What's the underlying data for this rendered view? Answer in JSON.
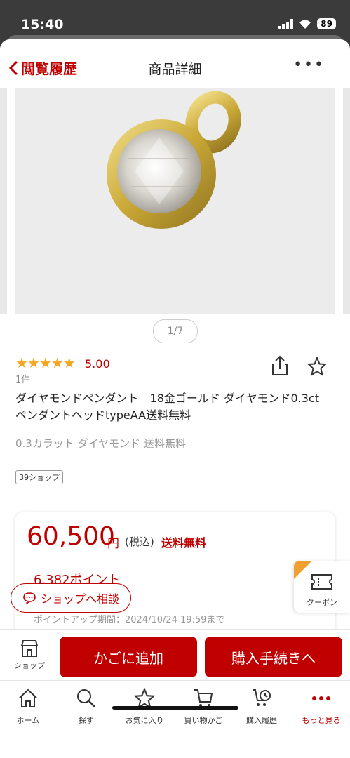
{
  "status": {
    "time": "15:40",
    "battery": "89"
  },
  "nav": {
    "back_label": "閲覧履歴",
    "title": "商品詳細",
    "more": "•••"
  },
  "gallery": {
    "pager": "1/7"
  },
  "rating": {
    "stars": "★★★★★",
    "score": "5.00",
    "count": "1件"
  },
  "product": {
    "name": "ダイヤモンドペンダント　18金ゴールド ダイヤモンド0.3ctペンダントヘッドtypeAA送料無料",
    "subtitle": "0.3カラット ダイヤモンド 送料無料",
    "tag": "39ショップ"
  },
  "price": {
    "amount": "60,500",
    "yen": "円",
    "tax": "(税込)",
    "shipping": "送料無料",
    "points": "6,382ポイント",
    "period": "ポイントアップ期間：2024/10/24 19:59まで"
  },
  "consult": {
    "label": "ショップへ相談"
  },
  "coupon": {
    "label": "クーポン"
  },
  "actions": {
    "shop_label": "ショップ",
    "cart_label": "かごに追加",
    "buy_label": "購入手続きへ"
  },
  "tabs": [
    {
      "label": "ホーム"
    },
    {
      "label": "探す"
    },
    {
      "label": "お気に入り"
    },
    {
      "label": "買い物かご"
    },
    {
      "label": "購入履歴"
    },
    {
      "label": "もっと見る"
    }
  ],
  "colors": {
    "accent": "#c00000",
    "star": "#f5a623",
    "gold": "#d8b94a"
  }
}
